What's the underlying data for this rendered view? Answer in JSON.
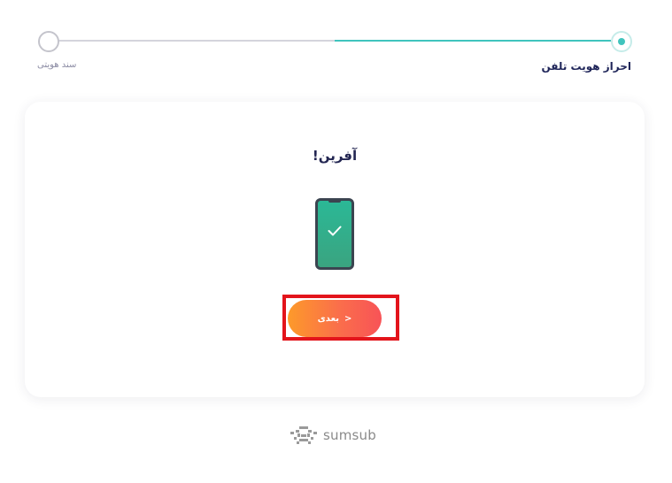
{
  "stepper": {
    "steps": [
      {
        "label": "سند هویتی",
        "state": "pending"
      },
      {
        "label": "احراز هویت تلفن",
        "state": "active"
      }
    ],
    "progress_color": "#40c4bd"
  },
  "card": {
    "title": "آفرین!",
    "illustration": "phone-verified-icon",
    "next_button": {
      "label": "بعدی",
      "arrow": ">",
      "gradient": [
        "#fd9a2a",
        "#f85357"
      ]
    },
    "highlight_color": "#e3141b"
  },
  "footer": {
    "brand": "sumsub"
  }
}
